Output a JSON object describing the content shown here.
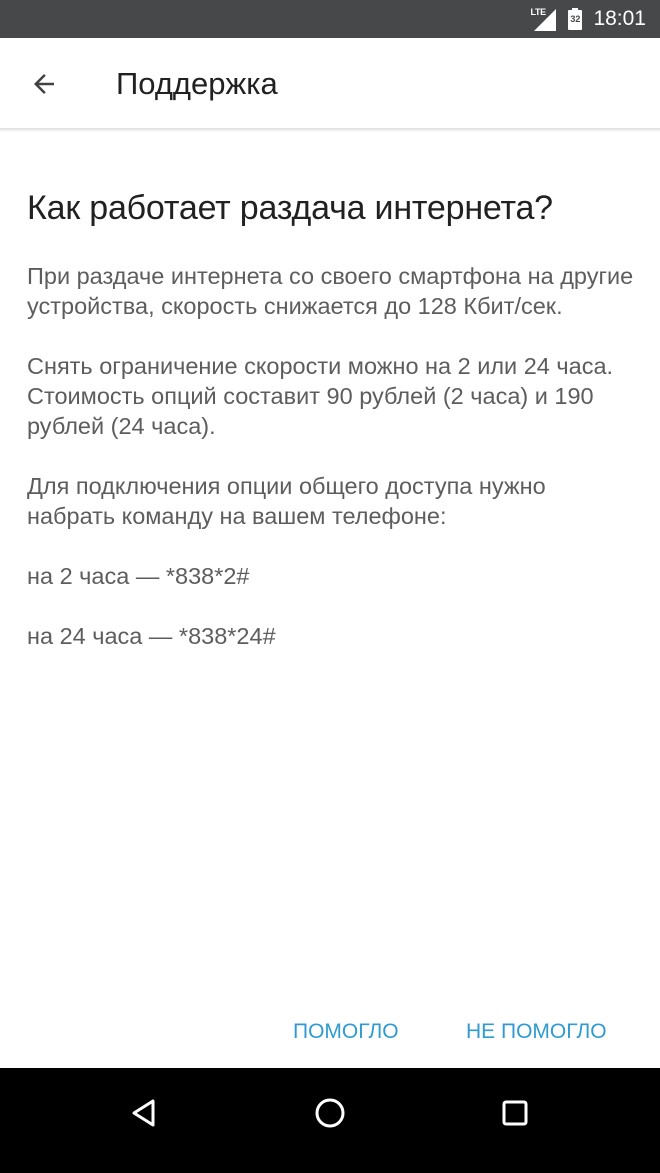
{
  "status_bar": {
    "network_label": "LTE",
    "battery_level": "32",
    "time": "18:01"
  },
  "toolbar": {
    "back_icon": "arrow-left-icon",
    "title": "Поддержка"
  },
  "article": {
    "title": "Как работает раздача интернета?",
    "paragraphs": [
      "При раздаче интернета со своего смартфона на другие устройства, скорость снижается до 128 Кбит/сек.",
      "Снять ограничение скорости можно на 2 или 24 часа. Стоимость опций составит 90 рублей (2 часа) и 190 рублей (24 часа).",
      "Для подключения опции общего доступа нужно набрать команду на вашем телефоне:",
      "на 2 часа — *838*2#",
      "на 24 часа — *838*24#"
    ]
  },
  "feedback": {
    "helped_label": "ПОМОГЛО",
    "not_helped_label": "НЕ ПОМОГЛО"
  },
  "navigation": {
    "back_icon": "triangle-back-icon",
    "home_icon": "circle-home-icon",
    "recents_icon": "square-recents-icon"
  },
  "colors": {
    "status_bar": "#47484a",
    "accent": "#2f9bd1",
    "title_text": "#212121",
    "body_text": "#5d5d5d",
    "nav_bar": "#000000"
  }
}
